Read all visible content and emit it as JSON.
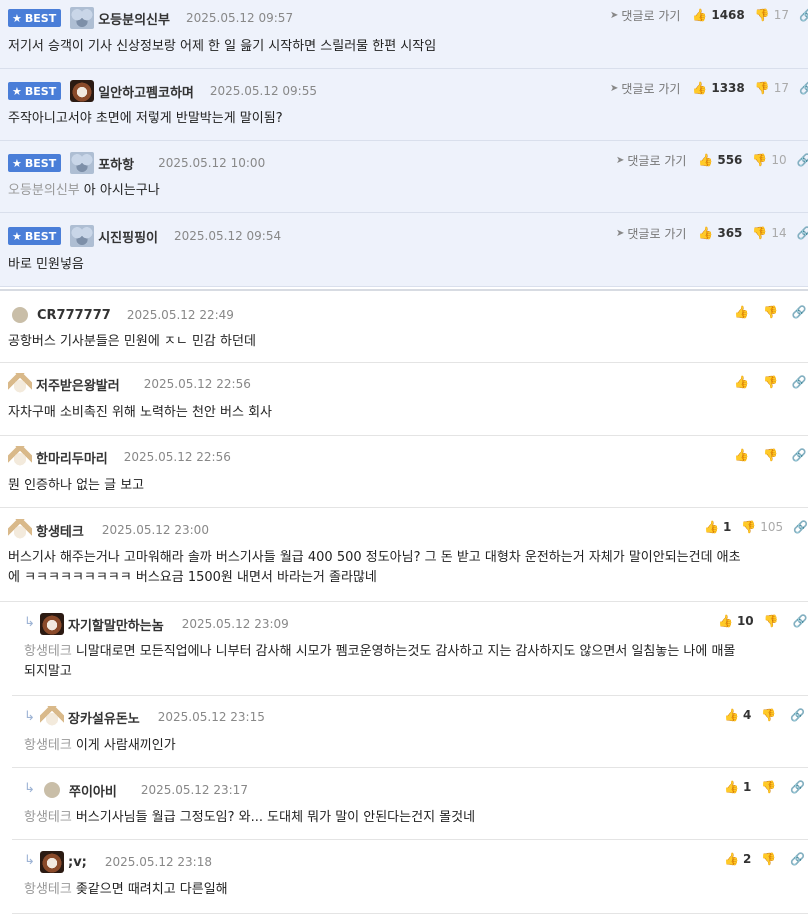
{
  "labels": {
    "best": "BEST",
    "goto": "댓글로 가기",
    "star_glyph": "★",
    "arrow_glyph": "➤",
    "reply_glyph": "↳",
    "like_glyph": "👍",
    "dislike_glyph": "👎",
    "link_glyph": "🔗"
  },
  "best_comments": [
    {
      "nick": "오등분의신부",
      "date": "2025.05.12 09:57",
      "likes": "1468",
      "dislikes": "17",
      "avatar": "koala-avatar",
      "text": "저기서 승객이 기사 신상정보랑 어제 한 일 읊기 시작하면 스릴러물 한편 시작임"
    },
    {
      "nick": "일안하고펨코하며",
      "date": "2025.05.12 09:55",
      "likes": "1338",
      "dislikes": "17",
      "avatar": "dog-avatar",
      "text": "주작아니고서야 초면에 저렇게 반말박는게 말이됨?"
    },
    {
      "nick": "포하항",
      "date": "2025.05.12 10:00",
      "likes": "556",
      "dislikes": "10",
      "avatar": "koala-avatar",
      "mention": "오등분의신부",
      "text": "아 아시는구나"
    },
    {
      "nick": "시진핑핑이",
      "date": "2025.05.12 09:54",
      "likes": "365",
      "dislikes": "14",
      "avatar": "koala-avatar",
      "text": "바로 민원넣음"
    }
  ],
  "comments": [
    {
      "nick": "CR777777",
      "date": "2025.05.12 22:49",
      "likes": "",
      "dislikes": "",
      "avatar": "dot-avatar",
      "text": "공항버스 기사분들은 민원에 ㅈㄴ 민감 하던데"
    },
    {
      "nick": "저주받은왕발러",
      "date": "2025.05.12 22:56",
      "likes": "",
      "dislikes": "",
      "avatar": "chihuahua-avatar",
      "text": "자차구매 소비촉진 위해 노력하는 천안 버스 회사"
    },
    {
      "nick": "한마리두마리",
      "date": "2025.05.12 22:56",
      "likes": "",
      "dislikes": "",
      "avatar": "chihuahua-avatar",
      "text": "뭔 인증하나 없는 글 보고"
    },
    {
      "nick": "항생테크",
      "date": "2025.05.12 23:00",
      "likes": "1",
      "dislikes": "105",
      "avatar": "chihuahua-avatar",
      "text1": "버스기사 해주는거나 고마워해라 솔까 버스기사들 월급 400 500 정도아님? 그 돈 받고 대형차 운전하는거 자체가 말이안되는건데 애초",
      "text2": "에 ㅋㅋㅋㅋㅋㅋㅋㅋㅋ 버스요금 1500원 내면서 바라는거 졸라많네"
    }
  ],
  "replies": [
    {
      "nick": "자기할말만하는놈",
      "date": "2025.05.12 23:09",
      "likes": "10",
      "dislikes": "",
      "avatar": "dog-avatar",
      "mention": "항생테크",
      "text1": "니말대로면 모든직업에나 니부터 감사해 시모가 펨코운영하는것도 감사하고 지는 감사하지도 않으면서 일침놓는 나에 매몰",
      "text2": "되지말고"
    },
    {
      "nick": "장카설유돈노",
      "date": "2025.05.12 23:15",
      "likes": "4",
      "dislikes": "",
      "avatar": "chihuahua-avatar",
      "mention": "항생테크",
      "text": "이게 사람새끼인가"
    },
    {
      "nick": "쭈이아비",
      "date": "2025.05.12 23:17",
      "likes": "1",
      "dislikes": "",
      "avatar": "dot-avatar",
      "mention": "항생테크",
      "text": "버스기사님들 월급 그정도임? 와... 도대체 뭐가 말이 안된다는건지 몰것네"
    },
    {
      "nick": ";v;",
      "date": "2025.05.12 23:18",
      "likes": "2",
      "dislikes": "",
      "avatar": "dog-avatar",
      "mention": "항생테크",
      "text": "좆같으면 때려치고 다른일해"
    }
  ],
  "colors": {
    "best_bg": "#eef2fb",
    "badge": "#4a7ed8"
  }
}
